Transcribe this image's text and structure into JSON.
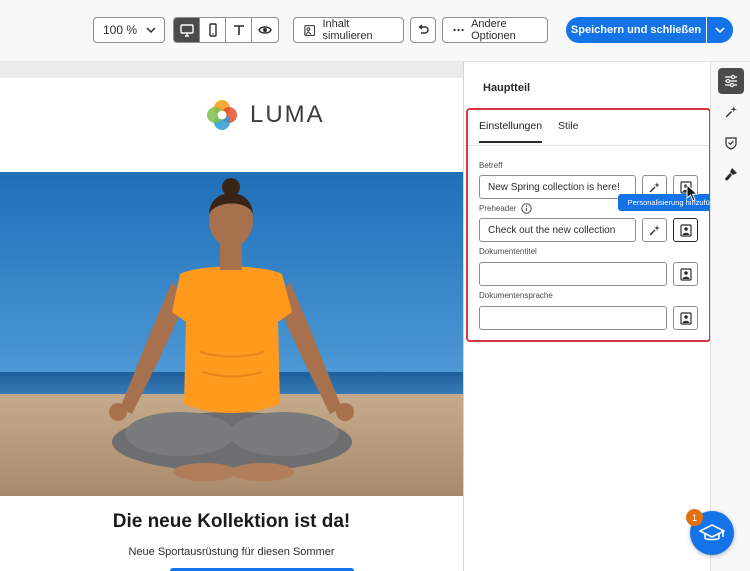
{
  "toolbar": {
    "zoom_value": "100 %",
    "simulate_label": "Inhalt simulieren",
    "more_options_label": "Andere Optionen",
    "save_label": "Speichern und schließen"
  },
  "email": {
    "logo_text": "LUMA",
    "headline": "Die neue Kollektion ist da!",
    "subline": "Neue Sportausrüstung für diesen Sommer"
  },
  "panel": {
    "title": "Hauptteil",
    "tabs": [
      {
        "label": "Einstellungen",
        "active": true
      },
      {
        "label": "Stile",
        "active": false
      }
    ],
    "fields": {
      "subject": {
        "label": "Betreff",
        "value": "New Spring collection is here!"
      },
      "preheader": {
        "label": "Preheader",
        "value": "Check out the new collection"
      },
      "document_title": {
        "label": "Dokumententitel",
        "value": ""
      },
      "document_language": {
        "label": "Dokumentensprache",
        "value": ""
      }
    },
    "tooltip": "Personalisierung hinzufügen"
  },
  "help": {
    "badge_count": "1"
  },
  "colors": {
    "accent": "#1473e6",
    "highlight": "#d7373f",
    "badge": "#e46f0f"
  }
}
